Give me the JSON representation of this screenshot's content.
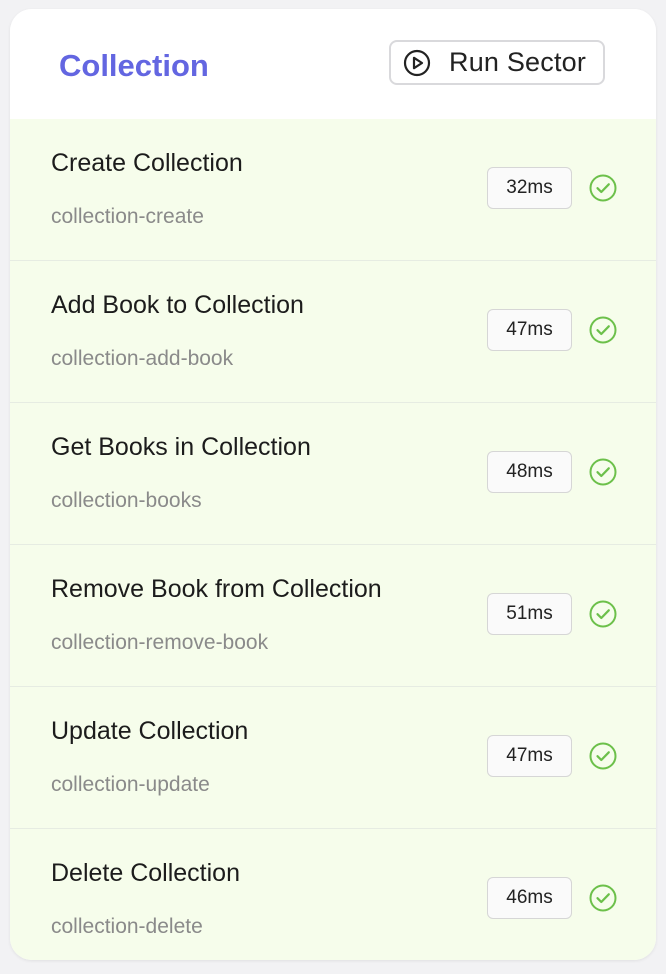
{
  "header": {
    "title": "Collection",
    "run_label": "Run Sector"
  },
  "colors": {
    "accent": "#6366e1",
    "success": "#6cc04a",
    "row_bg": "#f6fdeb"
  },
  "tests": [
    {
      "name": "Create Collection",
      "slug": "collection-create",
      "time": "32ms",
      "status": "passed",
      "icon": "check-circle-icon"
    },
    {
      "name": "Add Book to Collection",
      "slug": "collection-add-book",
      "time": "47ms",
      "status": "passed",
      "icon": "check-circle-icon"
    },
    {
      "name": "Get Books in Collection",
      "slug": "collection-books",
      "time": "48ms",
      "status": "passed",
      "icon": "check-circle-icon"
    },
    {
      "name": "Remove Book from Collection",
      "slug": "collection-remove-book",
      "time": "51ms",
      "status": "passed",
      "icon": "check-circle-icon"
    },
    {
      "name": "Update Collection",
      "slug": "collection-update",
      "time": "47ms",
      "status": "passed",
      "icon": "check-circle-icon"
    },
    {
      "name": "Delete Collection",
      "slug": "collection-delete",
      "time": "46ms",
      "status": "passed",
      "icon": "check-circle-icon"
    }
  ]
}
